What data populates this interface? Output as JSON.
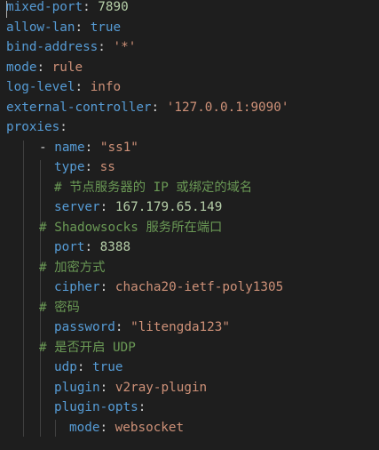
{
  "lines": [
    {
      "key": "mixed-port",
      "sep": ": ",
      "value": "7890",
      "comment": ""
    },
    {
      "key": "allow-lan",
      "sep": ": ",
      "value": "true",
      "comment": ""
    },
    {
      "key": "bind-address",
      "sep": ": ",
      "value": "'*'",
      "comment": ""
    },
    {
      "key": "mode",
      "sep": ": ",
      "value": "rule",
      "comment": ""
    },
    {
      "key": "log-level",
      "sep": ": ",
      "value": "info",
      "comment": ""
    },
    {
      "key": "external-controller",
      "sep": ": ",
      "value": "'127.0.0.1:9090'",
      "comment": ""
    },
    {
      "key": "proxies",
      "sep": ":",
      "value": "",
      "comment": ""
    },
    {
      "dash": "- ",
      "key": "name",
      "sep": ": ",
      "value": "\"ss1\"",
      "comment": ""
    },
    {
      "key": "type",
      "sep": ": ",
      "value": "ss",
      "comment": ""
    },
    {
      "key": "",
      "sep": "",
      "value": "",
      "comment": "# 节点服务器的 IP 或绑定的域名"
    },
    {
      "key": "server",
      "sep": ": ",
      "value": "167.179.65.149",
      "comment": ""
    },
    {
      "key": "",
      "sep": "",
      "value": "",
      "comment": "# Shadowsocks 服务所在端口"
    },
    {
      "key": "port",
      "sep": ": ",
      "value": "8388",
      "comment": ""
    },
    {
      "key": "",
      "sep": "",
      "value": "",
      "comment": "# 加密方式"
    },
    {
      "key": "cipher",
      "sep": ": ",
      "value": "chacha20-ietf-poly1305",
      "comment": ""
    },
    {
      "key": "",
      "sep": "",
      "value": "",
      "comment": "# 密码"
    },
    {
      "key": "password",
      "sep": ": ",
      "value": "\"litengda123\"",
      "comment": ""
    },
    {
      "key": "",
      "sep": "",
      "value": "",
      "comment": "# 是否开启 UDP"
    },
    {
      "key": "udp",
      "sep": ": ",
      "value": "true",
      "comment": ""
    },
    {
      "key": "plugin",
      "sep": ": ",
      "value": "v2ray-plugin",
      "comment": ""
    },
    {
      "key": "plugin-opts",
      "sep": ":",
      "value": "",
      "comment": ""
    },
    {
      "key": "mode",
      "sep": ": ",
      "value": "websocket",
      "comment": ""
    }
  ],
  "colors": {
    "background": "#1e1e1e",
    "key": "#569cd6",
    "number": "#b5cea8",
    "boolean": "#569cd6",
    "string": "#ce9178",
    "comment": "#6a9955",
    "indent_guide": "#404040"
  }
}
